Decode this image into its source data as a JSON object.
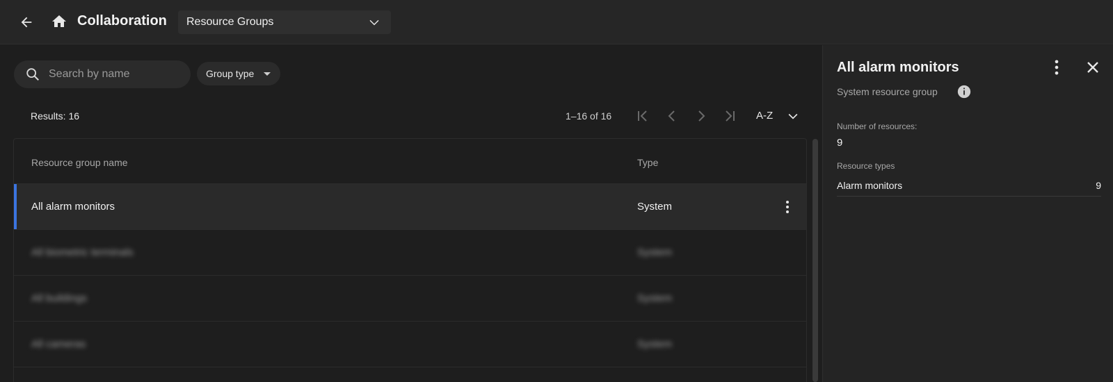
{
  "header": {
    "title": "Collaboration",
    "section_selected": "Resource Groups"
  },
  "toolbar": {
    "search_placeholder": "Search by name",
    "filter_label": "Group type"
  },
  "list": {
    "results_label": "Results: 16",
    "pagination": "1–16 of 16",
    "sort_label": "A-Z",
    "columns": {
      "name": "Resource group name",
      "type": "Type"
    },
    "rows": [
      {
        "name": "All alarm monitors",
        "type": "System",
        "selected": true
      },
      {
        "name": "All biometric terminals",
        "type": "System"
      },
      {
        "name": "All buildings",
        "type": "System"
      },
      {
        "name": "All cameras",
        "type": "System"
      }
    ]
  },
  "panel": {
    "title": "All alarm monitors",
    "subtitle": "System resource group",
    "count_label": "Number of resources:",
    "count_value": "9",
    "types_label": "Resource types",
    "types": [
      {
        "name": "Alarm monitors",
        "count": "9"
      }
    ]
  },
  "colors": {
    "accent": "#3b74e0",
    "background": "#1e1e1e",
    "panel": "#242424"
  },
  "icons": [
    "arrow-left-icon",
    "home-icon",
    "chevron-down-icon",
    "search-icon",
    "caret-down-icon",
    "first-page-icon",
    "chevron-left-icon",
    "chevron-right-icon",
    "last-page-icon",
    "more-vertical-icon",
    "close-icon",
    "info-icon"
  ]
}
